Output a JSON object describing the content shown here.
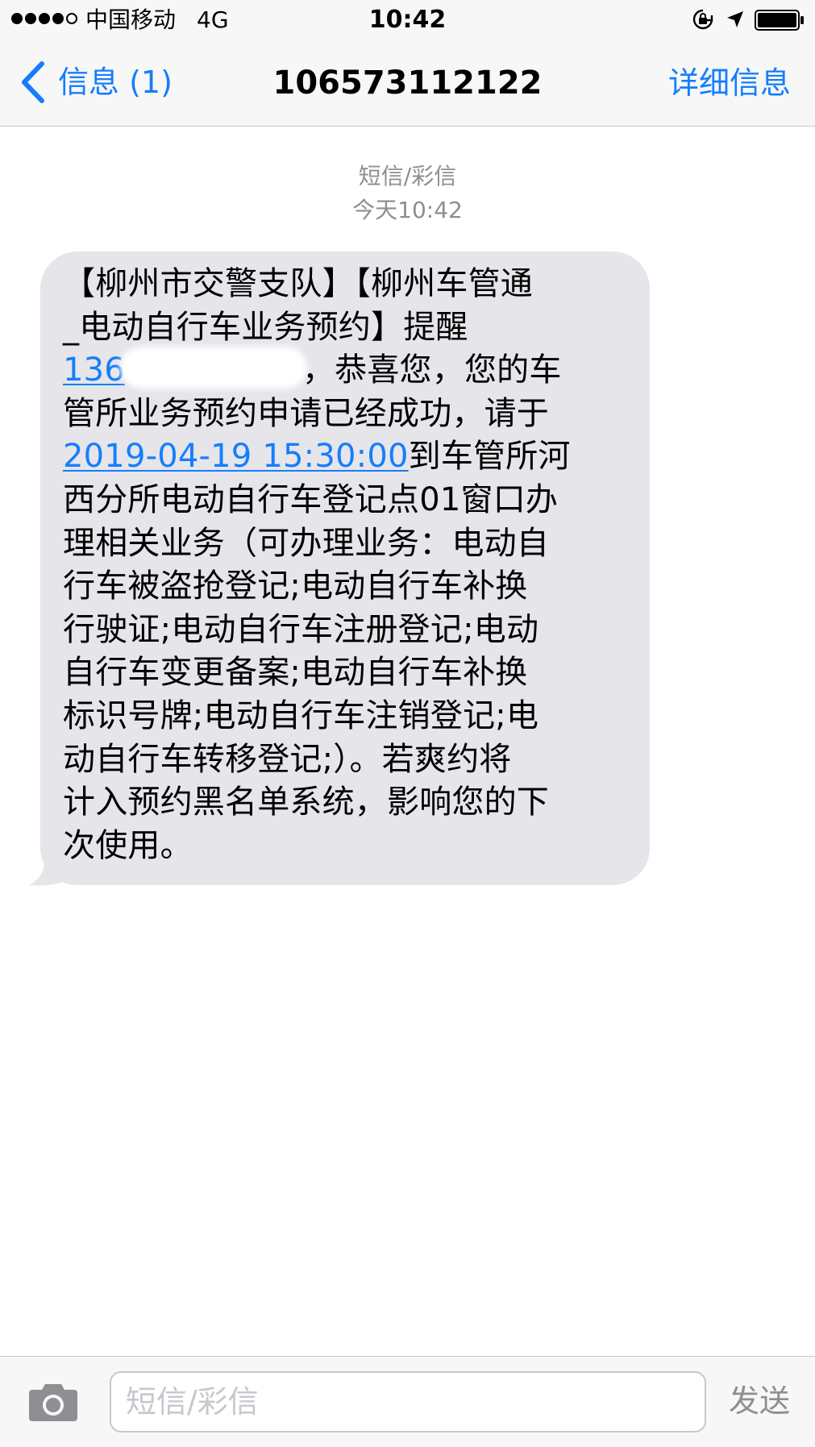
{
  "status_bar": {
    "carrier": "中国移动",
    "network": "4G",
    "time": "10:42"
  },
  "nav": {
    "back_label": "信息 (1)",
    "title": "106573112122",
    "details_label": "详细信息"
  },
  "conversation": {
    "type_label": "短信/彩信",
    "timestamp": "今天10:42"
  },
  "message": {
    "lines": {
      "l1": "【柳州市交警支队】【柳州车管通",
      "l2": "_电动自行车业务预约】提醒",
      "l3_phone": "136",
      "l3_rest": "，恭喜您，您的车",
      "l4": "管所业务预约申请已经成功，请于",
      "l5_datetime": "2019-04-19 15:30:00",
      "l5_rest": "到车管所河",
      "l6": "西分所电动自行车登记点01窗口办",
      "l7": "理相关业务（可办理业务：电动自",
      "l8": "行车被盗抢登记;电动自行车补换",
      "l9": "行驶证;电动自行车注册登记;电动",
      "l10": "自行车变更备案;电动自行车补换",
      "l11": "标识号牌;电动自行车注销登记;电",
      "l12": "动自行车转移登记;）。若爽约将",
      "l13": "计入预约黑名单系统，影响您的下",
      "l14": "次使用。"
    }
  },
  "input_bar": {
    "placeholder": "短信/彩信",
    "send_label": "发送"
  },
  "colors": {
    "accent": "#157efb",
    "bubble": "#e5e5ea",
    "bar_bg": "#f7f7f7",
    "muted": "#8e8e93"
  },
  "icons": {
    "signal": "signal-dots-icon",
    "lock": "orientation-lock-icon",
    "location": "location-arrow-icon",
    "battery": "battery-icon",
    "back": "chevron-left-icon",
    "camera": "camera-icon"
  }
}
